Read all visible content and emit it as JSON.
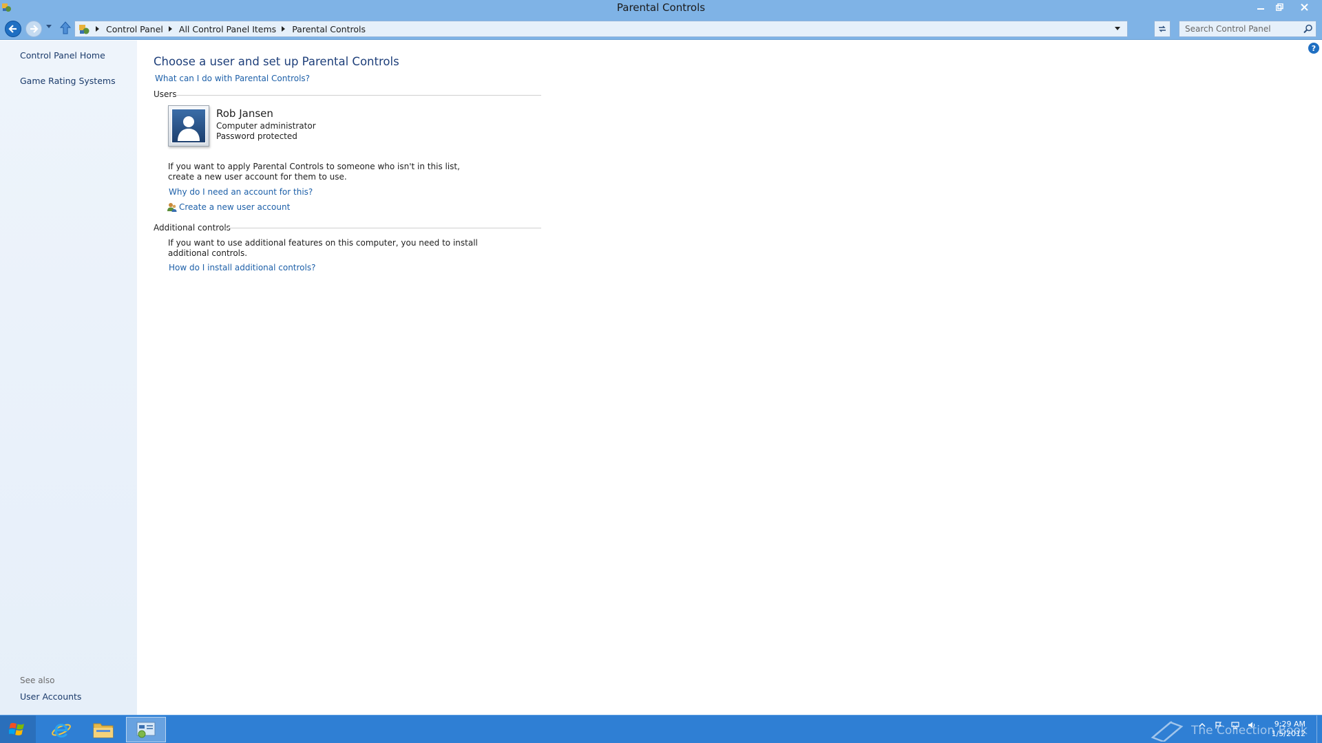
{
  "window": {
    "title": "Parental Controls",
    "minimize_icon": "minimize-icon",
    "maximize_icon": "restore-icon",
    "close_icon": "close-icon"
  },
  "address_bar": {
    "breadcrumbs": [
      "Control Panel",
      "All Control Panel Items",
      "Parental Controls"
    ],
    "search_placeholder": "Search Control Panel"
  },
  "left_pane": {
    "links": [
      "Control Panel Home",
      "Game Rating Systems"
    ],
    "see_also_label": "See also",
    "see_also_links": [
      "User Accounts"
    ]
  },
  "main": {
    "title": "Choose a user and set up Parental Controls",
    "help_link": "What can I do with Parental Controls?",
    "users_section": {
      "heading": "Users",
      "users": [
        {
          "name": "Rob Jansen",
          "role": "Computer administrator",
          "status": "Password protected"
        }
      ],
      "info_line1": "If you want to apply Parental Controls to someone who isn't in this list,",
      "info_line2": "create a new user account for them to use.",
      "why_link": "Why do I need an account for this?",
      "create_link": "Create a new user account"
    },
    "additional_section": {
      "heading": "Additional controls",
      "info_line1": "If you want to use additional features on this computer, you need to install",
      "info_line2": "additional controls.",
      "install_link": "How do I install additional controls?"
    }
  },
  "taskbar": {
    "apps": [
      "internet-explorer-icon",
      "file-explorer-icon",
      "control-panel-icon"
    ],
    "watermark": "The Collection Book",
    "clock_time": "9:29 AM",
    "clock_date": "1/5/2012"
  },
  "colors": {
    "chrome": "#7fb3e6",
    "link": "#1c5fa8",
    "heading": "#1e3f7a",
    "taskbar": "#2f7fd4"
  }
}
